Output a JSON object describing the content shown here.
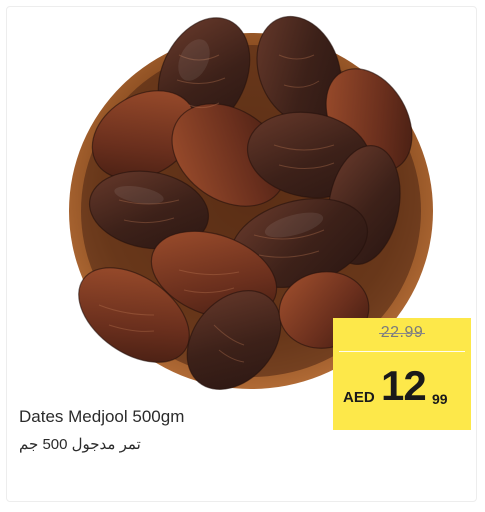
{
  "product": {
    "name_en": "Dates Medjool 500gm",
    "name_ar": "تمر مدجول 500 جم",
    "image": "dates-bowl-image"
  },
  "price": {
    "old": "22.99",
    "currency": "AED",
    "current_int": "12",
    "current_dec": "99"
  },
  "colors": {
    "price_badge": "#fde84a",
    "bowl": "#9a5a2a",
    "date_dark": "#4a2c22",
    "date_light": "#8a4a2f"
  }
}
